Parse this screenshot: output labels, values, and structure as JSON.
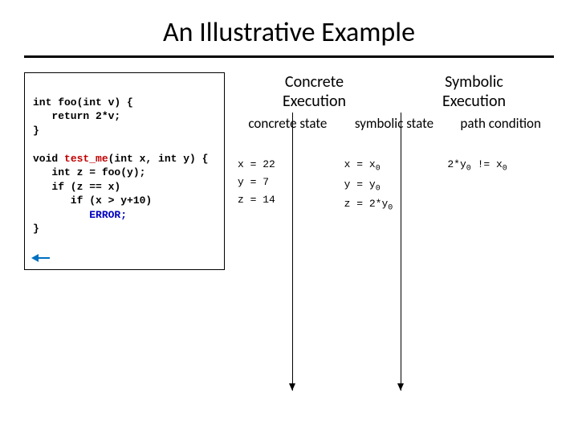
{
  "title": "An Illustrative Example",
  "code": {
    "l1": "int foo(int v) {",
    "l2": "   return 2*v;",
    "l3": "}",
    "l4": "",
    "l5a": "void ",
    "l5b": "test_me",
    "l5c": "(int x, int y) {",
    "l6": "   int z = foo(y);",
    "l7": "   if (z == x)",
    "l8": "      if (x > y+10)",
    "l9": "         ",
    "l9b": "ERROR;",
    "l10": "}"
  },
  "headers": {
    "concrete_exec": "Concrete Execution",
    "symbolic_exec": "Symbolic Execution",
    "concrete_state": "concrete state",
    "symbolic_state": "symbolic state",
    "path_condition": "path condition"
  },
  "concrete": {
    "x": "x = 22",
    "y": "y = 7",
    "z": "z = 14"
  },
  "symbolic": {
    "x_pre": "x = x",
    "x_sub": "0",
    "y_pre": "y = y",
    "y_sub": "0",
    "z_pre": "z = 2*y",
    "z_sub": "0"
  },
  "path": {
    "pre1": "2*y",
    "sub1": "0",
    "mid": " != x",
    "sub2": "0"
  }
}
